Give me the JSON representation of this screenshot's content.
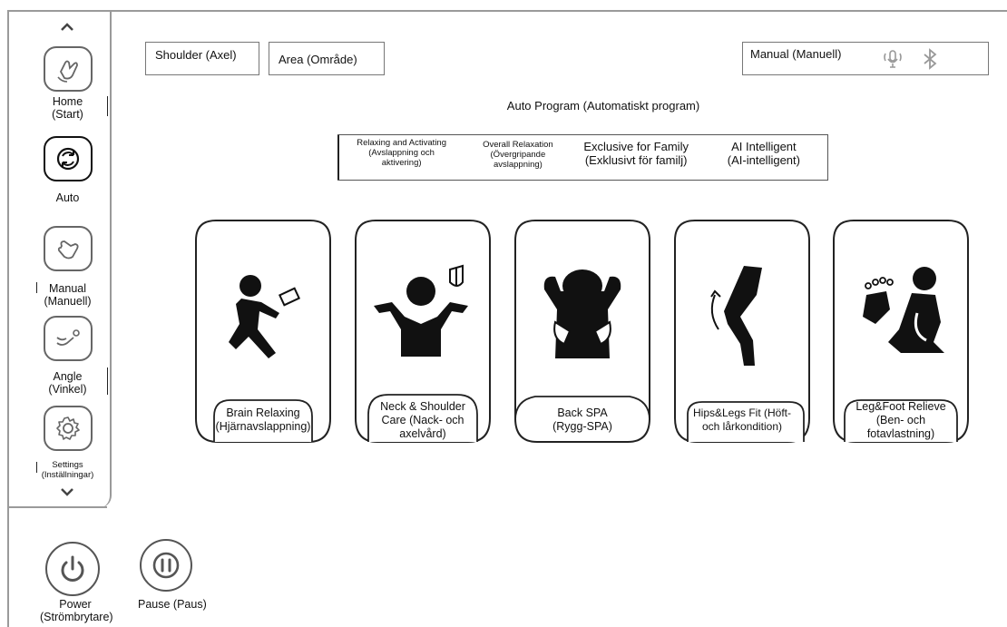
{
  "sidebar": {
    "scroll_up": "^",
    "scroll_down": "⌄",
    "items": [
      {
        "label": "Home\n(Start)",
        "icon": "hand-wave-icon"
      },
      {
        "label": "Auto",
        "icon": "sync-icon",
        "active": true
      },
      {
        "label": "Manual\n(Manuell)",
        "icon": "hand-tap-icon"
      },
      {
        "label": "Angle\n(Vinkel)",
        "icon": "recline-icon"
      },
      {
        "label": "Settings\n(Inställningar)",
        "icon": "gear-icon"
      }
    ]
  },
  "top_buttons": {
    "shoulder": "Shoulder (Axel)",
    "area": "Area (Område)",
    "manual": "Manual (Manuell)"
  },
  "auto_program_title": "Auto Program (Automatiskt program)",
  "tabs": [
    {
      "label": "Relaxing and Activating\n(Avslappning och\naktivering)",
      "active": true
    },
    {
      "label": "Overall Relaxation\n(Övergripande\navslappning)"
    },
    {
      "label": "Exclusive for Family\n(Exklusivt för familj)"
    },
    {
      "label": "AI Intelligent\n(AI-intelligent)"
    }
  ],
  "programs": [
    {
      "label": "Brain Relaxing\n(Hjärnavslappning)",
      "icon": "reading-person-icon"
    },
    {
      "label": "Neck & Shoulder\nCare (Nack- och\naxelvård)",
      "icon": "neck-shoulder-icon"
    },
    {
      "label": "Back SPA\n(Rygg-SPA)",
      "icon": "back-massage-icon"
    },
    {
      "label": "Hips&Legs Fit (Höft-\noch lårkondition)",
      "icon": "hips-legs-icon"
    },
    {
      "label": "Leg&Foot Relieve\n(Ben- och\nfotavlastning)",
      "icon": "foot-relief-icon"
    }
  ],
  "bottom": {
    "power": "Power\n(Strömbrytare)",
    "pause": "Pause (Paus)"
  },
  "colors": {
    "border": "#9a9a9a",
    "icon": "#111111"
  }
}
